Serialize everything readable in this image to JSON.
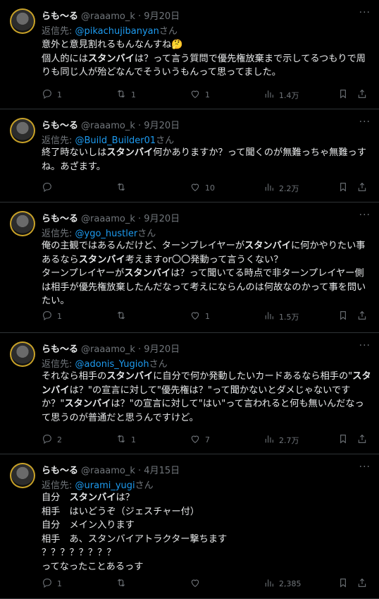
{
  "tweets": [
    {
      "name": "らも〜る",
      "handle_time": "@raaamo_k · 9月20日",
      "reply_prefix": "返信先:",
      "reply_to": "@pikachujibanyan",
      "reply_suffix": "さん",
      "body": "意外と意見割れるもんなんすね🤔\n個人的には**スタンバイ**は？って言う質問で優先権放棄まで示してるつもりで周りも同じ人が殆どなんでそういうもんって思ってました。",
      "replies": "1",
      "retweets": "1",
      "likes": "1",
      "views": "1.4万"
    },
    {
      "name": "らも〜る",
      "handle_time": "@raaamo_k · 9月20日",
      "reply_prefix": "返信先:",
      "reply_to": "@Build_Builder01",
      "reply_suffix": "さん",
      "body": "終了時ないしは**スタンバイ**何かありますか？って聞くのが無難っちゃ無難っすね。あざます。",
      "replies": "",
      "retweets": "",
      "likes": "10",
      "views": "2.2万"
    },
    {
      "name": "らも〜る",
      "handle_time": "@raaamo_k · 9月20日",
      "reply_prefix": "返信先:",
      "reply_to": "@ygo_hustler",
      "reply_suffix": "さん",
      "body": "俺の主観ではあるんだけど、ターンプレイヤーが**スタンバイ**に何かやりたい事あるなら**スタンバイ**考えますor〇〇発動って言うくない？\nターンプレイヤーが**スタンバイ**は？って聞いてる時点で非ターンプレイヤー側は相手が優先権放棄したんだなって考えにならんのは何故なのかって事を問いたい。",
      "replies": "1",
      "retweets": "",
      "likes": "1",
      "views": "1.5万"
    },
    {
      "name": "らも〜る",
      "handle_time": "@raaamo_k · 9月20日",
      "reply_prefix": "返信先:",
      "reply_to": "@adonis_Yugioh",
      "reply_suffix": "さん",
      "body": "それなら相手の**スタンバイ**に自分で何か発動したいカードあるなら相手の\"**スタンバイ**は？\"の宣言に対して\"優先権は？\"って聞かないとダメじゃないですか？\"**スタンバイ**は？\"の宣言に対して\"はい\"って言われると何も無いんだなって思うのが普通だと思うんですけど。",
      "replies": "2",
      "retweets": "1",
      "likes": "7",
      "views": "2.7万"
    },
    {
      "name": "らも〜る",
      "handle_time": "@raaamo_k · 4月15日",
      "reply_prefix": "返信先:",
      "reply_to": "@urami_yugi",
      "reply_suffix": "さん",
      "body": "自分　**スタンバイ**は？\n相手　はいどうぞ（ジェスチャー付）\n自分　メイン入ります\n相手　あ、スタンバイアトラクター撃ちます\n？？？？？？？？\nってなったことあるっす",
      "replies": "1",
      "retweets": "",
      "likes": "",
      "views": "2,385"
    }
  ]
}
